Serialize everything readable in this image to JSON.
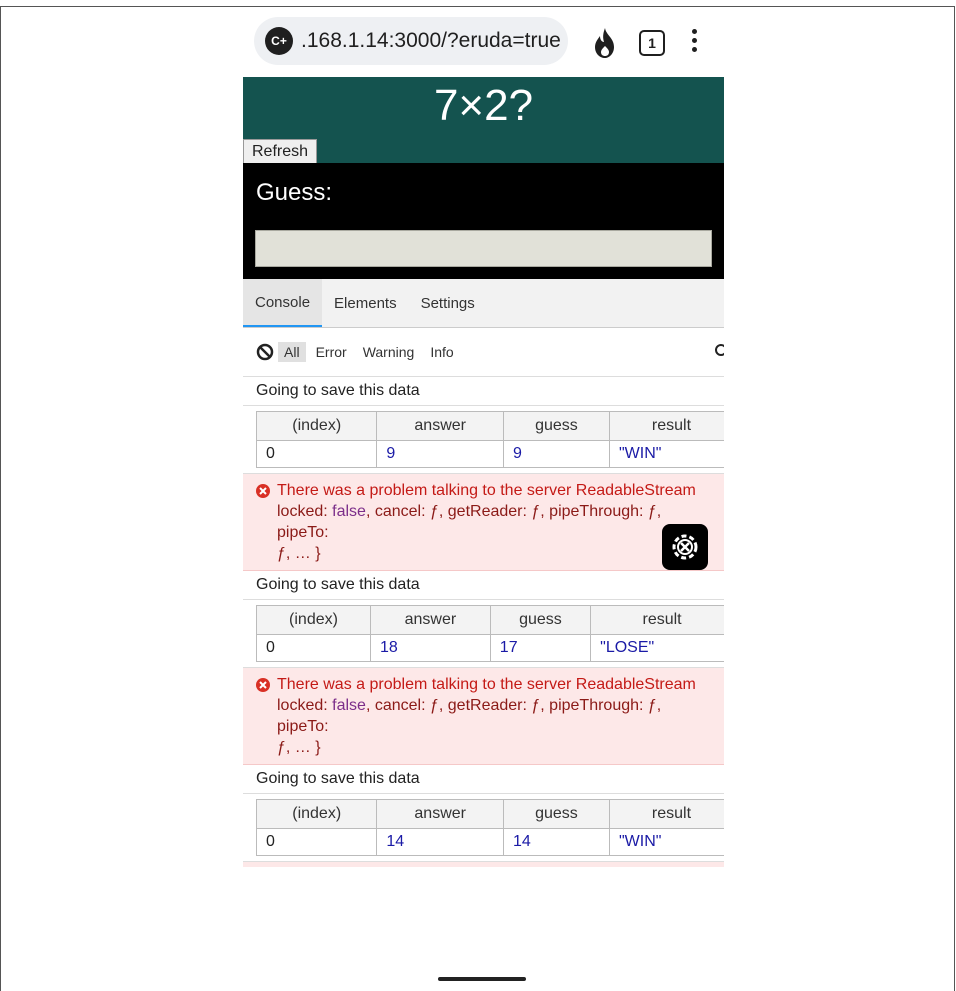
{
  "browser": {
    "url": ".168.1.14:3000/?eruda=true",
    "site_icon": "C+",
    "tab_count": "1"
  },
  "app": {
    "question": "7×2?",
    "refresh_label": "Refresh",
    "guess_label": "Guess:"
  },
  "devtools": {
    "tabs": [
      "Console",
      "Elements",
      "Settings"
    ],
    "filters": [
      "All",
      "Error",
      "Warning",
      "Info"
    ],
    "log_message": "Going to save this data",
    "table_headers": [
      "(index)",
      "answer",
      "guess",
      "result"
    ],
    "entries": [
      {
        "index": "0",
        "answer": "9",
        "guess": "9",
        "result": "\"WIN\""
      },
      {
        "index": "0",
        "answer": "18",
        "guess": "17",
        "result": "\"LOSE\""
      },
      {
        "index": "0",
        "answer": "14",
        "guess": "14",
        "result": "\"WIN\""
      }
    ],
    "error": {
      "prefix": "There was a problem talking to the server ReadableStream",
      "locked": "locked:",
      "false_kw": "false",
      "rest": ", cancel: ƒ, getReader: ƒ, pipeThrough: ƒ, pipeTo:",
      "tail": "ƒ, … }"
    }
  },
  "colors": {
    "header_bg": "#14534f",
    "guess_bg": "#000000",
    "error_bg": "#fde8e8",
    "error_text": "#c41a16"
  }
}
